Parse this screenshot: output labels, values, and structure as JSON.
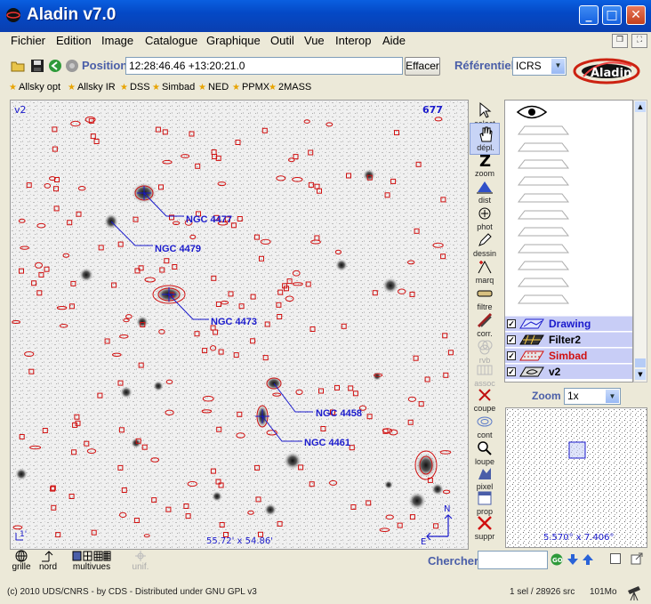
{
  "window": {
    "title": "Aladin v7.0",
    "minimize": "_",
    "maximize": "□",
    "close": "✕"
  },
  "menu": [
    "Fichier",
    "Edition",
    "Image",
    "Catalogue",
    "Graphique",
    "Outil",
    "Vue",
    "Interop",
    "Aide"
  ],
  "toolbar": {
    "position_label": "Position",
    "position_value": "12:28:46.46 +13:20:21.0",
    "clear_button": "Effacer",
    "frame_label": "Référentiel",
    "frame_value": "ICRS"
  },
  "surveys": [
    "Allsky opt",
    "Allsky IR",
    "DSS",
    "Simbad",
    "NED",
    "PPMX",
    "2MASS"
  ],
  "view": {
    "name": "v2",
    "count": "677",
    "fov": "55.72' x 54.86'",
    "objects": [
      {
        "name": "NGC 4477"
      },
      {
        "name": "NGC 4479"
      },
      {
        "name": "NGC 4473"
      },
      {
        "name": "NGC 4458"
      },
      {
        "name": "NGC 4461"
      }
    ],
    "compass_n": "N",
    "compass_e": "E",
    "scale": "1'"
  },
  "vertical_tools": [
    "select",
    "dépl.",
    "zoom",
    "dist",
    "phot",
    "dessin",
    "marq",
    "filtre",
    "corr.",
    "rvb",
    "assoc",
    "coupe",
    "cont",
    "loupe",
    "pixel",
    "prop",
    "suppr"
  ],
  "layers": [
    {
      "name": "Drawing",
      "color": "#1a1acc"
    },
    {
      "name": "Filter2",
      "color": "#000000"
    },
    {
      "name": "Simbad",
      "color": "#d01010"
    },
    {
      "name": "v2",
      "color": "#000000"
    }
  ],
  "zoom": {
    "label": "Zoom",
    "value": "1x"
  },
  "overview": {
    "fov": "5.570° x 7.406°"
  },
  "bottom_tools": [
    "grille",
    "nord",
    "multivues",
    "unif."
  ],
  "search": {
    "label": "Chercher",
    "value": ""
  },
  "status": {
    "copyright": "(c) 2010 UDS/CNRS - by CDS - Distributed under GNU GPL v3",
    "selection": "1 sel / 28926 src",
    "memory": "101Mo"
  },
  "colors": {
    "accent": "#4a5ea8",
    "catalog": "#d01010",
    "labels": "#1a1acc"
  }
}
